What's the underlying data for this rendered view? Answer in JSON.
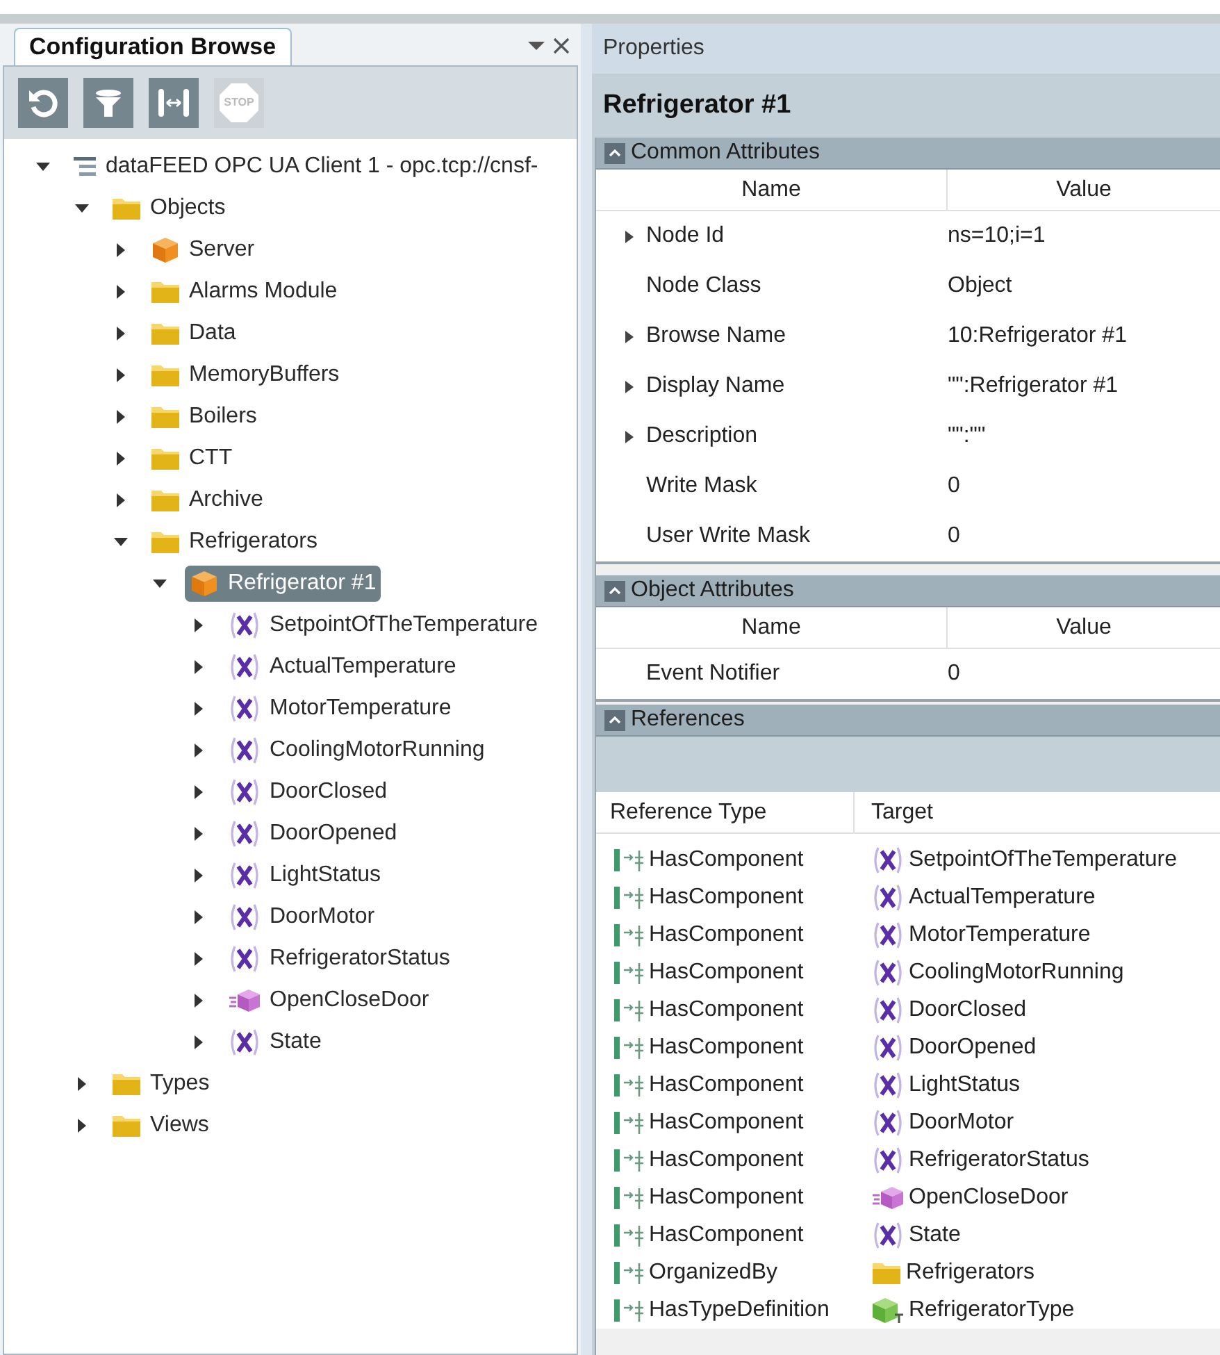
{
  "browser": {
    "tab": {
      "label": "Configuration Browse",
      "selected": true
    },
    "toolbar": [
      {
        "kind": "refresh",
        "disabled": false
      },
      {
        "kind": "filter",
        "disabled": false
      },
      {
        "kind": "columns",
        "disabled": false
      },
      {
        "kind": "stop",
        "label": "STOP",
        "disabled": true
      }
    ],
    "tree": [
      {
        "label": "dataFEED OPC UA Client 1 - opc.tcp://cnsf-",
        "kind": "client",
        "expanded": true,
        "selected": false,
        "children": [
          {
            "label": "Objects",
            "kind": "folder",
            "expanded": true,
            "selected": false,
            "children": [
              {
                "label": "Server",
                "kind": "object",
                "expanded": false,
                "selected": false
              },
              {
                "label": "Alarms Module",
                "kind": "folder",
                "expanded": false,
                "selected": false
              },
              {
                "label": "Data",
                "kind": "folder",
                "expanded": false,
                "selected": false
              },
              {
                "label": "MemoryBuffers",
                "kind": "folder",
                "expanded": false,
                "selected": false
              },
              {
                "label": "Boilers",
                "kind": "folder",
                "expanded": false,
                "selected": false
              },
              {
                "label": "CTT",
                "kind": "folder",
                "expanded": false,
                "selected": false
              },
              {
                "label": "Archive",
                "kind": "folder",
                "expanded": false,
                "selected": false
              },
              {
                "label": "Refrigerators",
                "kind": "folder",
                "expanded": true,
                "selected": false,
                "children": [
                  {
                    "label": "Refrigerator #1",
                    "kind": "object",
                    "expanded": true,
                    "selected": true,
                    "children": [
                      {
                        "label": "SetpointOfTheTemperature",
                        "kind": "variable",
                        "expanded": false,
                        "selected": false
                      },
                      {
                        "label": "ActualTemperature",
                        "kind": "variable",
                        "expanded": false,
                        "selected": false
                      },
                      {
                        "label": "MotorTemperature",
                        "kind": "variable",
                        "expanded": false,
                        "selected": false
                      },
                      {
                        "label": "CoolingMotorRunning",
                        "kind": "variable",
                        "expanded": false,
                        "selected": false
                      },
                      {
                        "label": "DoorClosed",
                        "kind": "variable",
                        "expanded": false,
                        "selected": false
                      },
                      {
                        "label": "DoorOpened",
                        "kind": "variable",
                        "expanded": false,
                        "selected": false
                      },
                      {
                        "label": "LightStatus",
                        "kind": "variable",
                        "expanded": false,
                        "selected": false
                      },
                      {
                        "label": "DoorMotor",
                        "kind": "variable",
                        "expanded": false,
                        "selected": false
                      },
                      {
                        "label": "RefrigeratorStatus",
                        "kind": "variable",
                        "expanded": false,
                        "selected": false
                      },
                      {
                        "label": "OpenCloseDoor",
                        "kind": "method",
                        "expanded": false,
                        "selected": false
                      },
                      {
                        "label": "State",
                        "kind": "variable",
                        "expanded": false,
                        "selected": false
                      }
                    ]
                  }
                ]
              }
            ]
          },
          {
            "label": "Types",
            "kind": "folder",
            "expanded": false,
            "selected": false
          },
          {
            "label": "Views",
            "kind": "folder",
            "expanded": false,
            "selected": false
          }
        ]
      }
    ]
  },
  "properties": {
    "title": "Properties",
    "node_name": "Refrigerator #1",
    "common_attributes": {
      "title": "Common Attributes",
      "expanded": true,
      "columns": [
        "Name",
        "Value"
      ],
      "rows": [
        {
          "name": "Node Id",
          "value": "ns=10;i=1",
          "expandable": true
        },
        {
          "name": "Node Class",
          "value": "Object",
          "expandable": false
        },
        {
          "name": "Browse Name",
          "value": "10:Refrigerator #1",
          "expandable": true
        },
        {
          "name": "Display Name",
          "value": "\"\":Refrigerator #1",
          "expandable": true
        },
        {
          "name": "Description",
          "value": "\"\":\"\"",
          "expandable": true
        },
        {
          "name": "Write Mask",
          "value": "0",
          "expandable": false
        },
        {
          "name": "User Write Mask",
          "value": "0",
          "expandable": false
        }
      ]
    },
    "object_attributes": {
      "title": "Object Attributes",
      "expanded": true,
      "columns": [
        "Name",
        "Value"
      ],
      "rows": [
        {
          "name": "Event Notifier",
          "value": "0",
          "expandable": false
        }
      ]
    },
    "references": {
      "title": "References",
      "expanded": true,
      "columns": [
        "Reference Type",
        "Target"
      ],
      "rows": [
        {
          "type": "HasComponent",
          "target": "SetpointOfTheTemperature",
          "kind": "variable"
        },
        {
          "type": "HasComponent",
          "target": "ActualTemperature",
          "kind": "variable"
        },
        {
          "type": "HasComponent",
          "target": "MotorTemperature",
          "kind": "variable"
        },
        {
          "type": "HasComponent",
          "target": "CoolingMotorRunning",
          "kind": "variable"
        },
        {
          "type": "HasComponent",
          "target": "DoorClosed",
          "kind": "variable"
        },
        {
          "type": "HasComponent",
          "target": "DoorOpened",
          "kind": "variable"
        },
        {
          "type": "HasComponent",
          "target": "LightStatus",
          "kind": "variable"
        },
        {
          "type": "HasComponent",
          "target": "DoorMotor",
          "kind": "variable"
        },
        {
          "type": "HasComponent",
          "target": "RefrigeratorStatus",
          "kind": "variable"
        },
        {
          "type": "HasComponent",
          "target": "OpenCloseDoor",
          "kind": "method"
        },
        {
          "type": "HasComponent",
          "target": "State",
          "kind": "variable"
        },
        {
          "type": "OrganizedBy",
          "target": "Refrigerators",
          "kind": "folder"
        },
        {
          "type": "HasTypeDefinition",
          "target": "RefrigeratorType",
          "kind": "objecttype"
        }
      ]
    }
  }
}
